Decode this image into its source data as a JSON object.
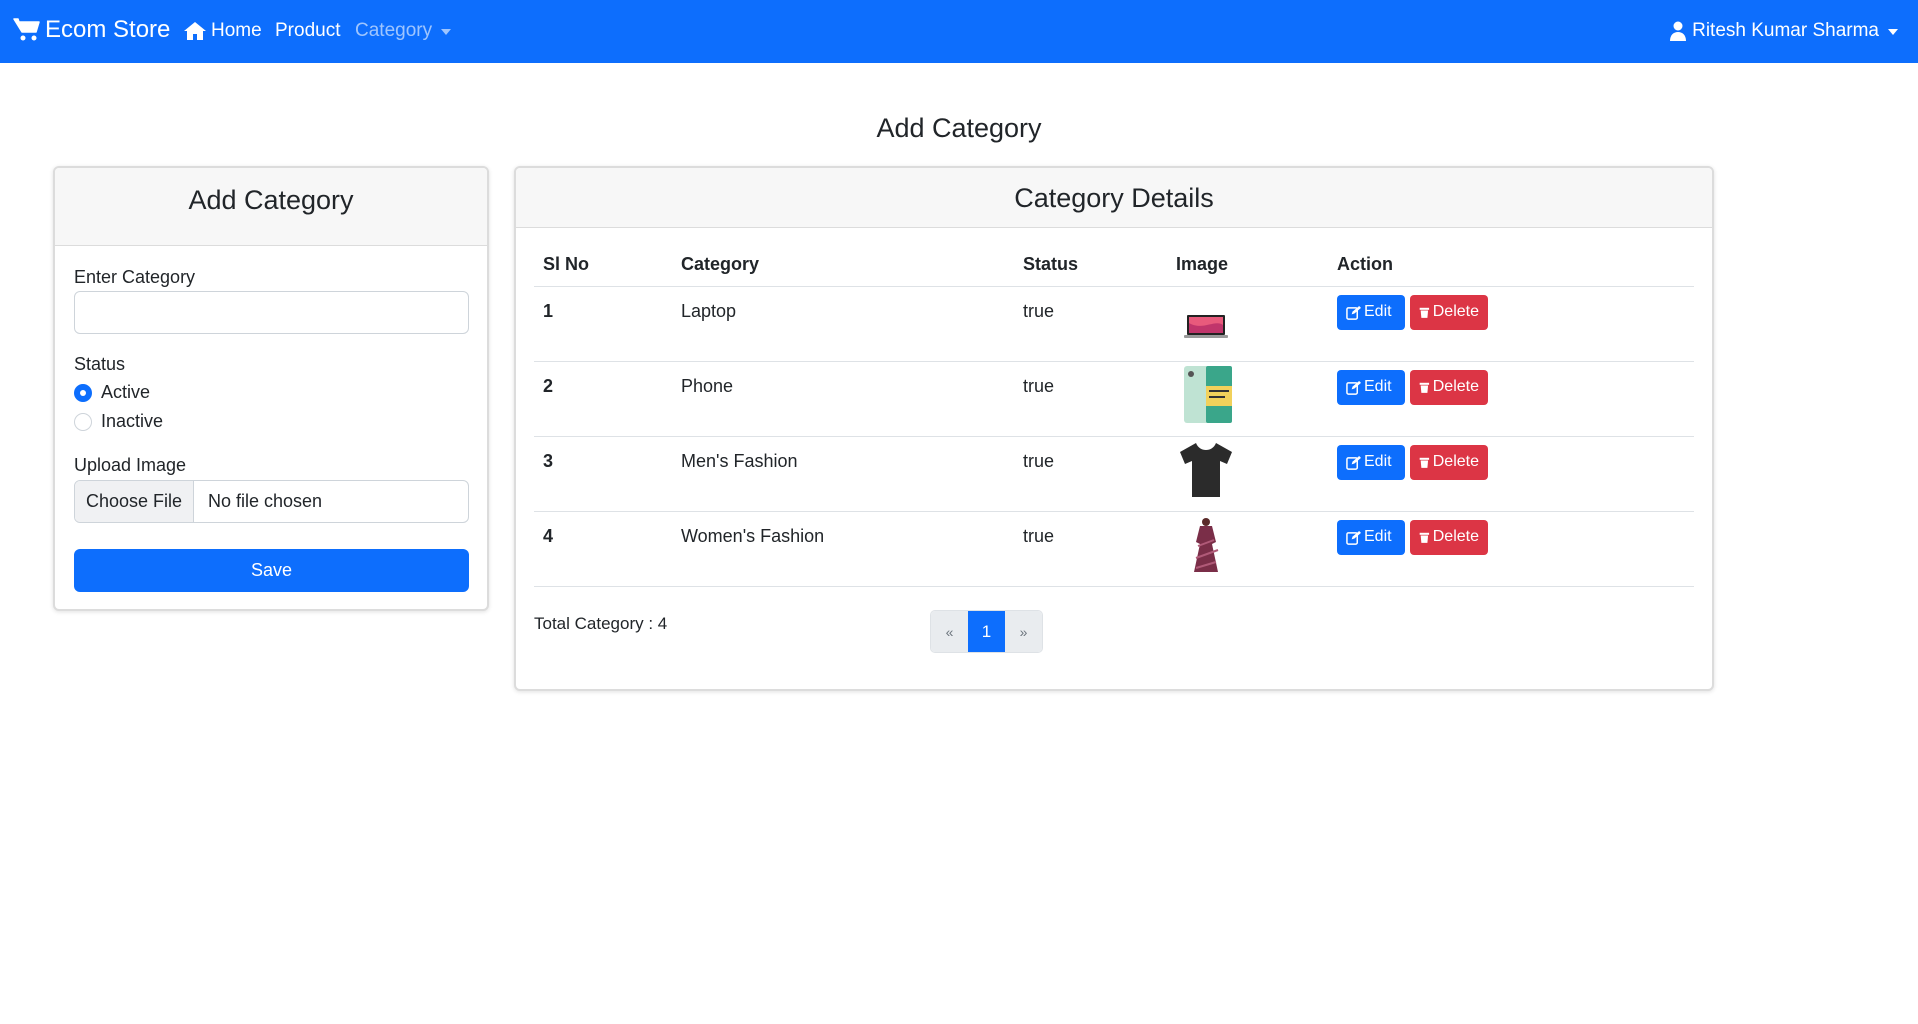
{
  "navbar": {
    "brand": "Ecom Store",
    "home": "Home",
    "product": "Product",
    "category": "Category",
    "user": "Ritesh Kumar Sharma"
  },
  "page_title": "Add Category",
  "form": {
    "header": "Add Category",
    "category_label": "Enter Category",
    "category_value": "",
    "status_label": "Status",
    "status_options": [
      "Active",
      "Inactive"
    ],
    "status_selected": "Active",
    "image_label": "Upload Image",
    "file_button": "Choose File",
    "file_status": "No file chosen",
    "save": "Save"
  },
  "details": {
    "header": "Category Details",
    "columns": [
      "Sl No",
      "Category",
      "Status",
      "Image",
      "Action"
    ],
    "rows": [
      {
        "sl": "1",
        "category": "Laptop",
        "status": "true",
        "image": "laptop-thumbnail"
      },
      {
        "sl": "2",
        "category": "Phone",
        "status": "true",
        "image": "phone-thumbnail"
      },
      {
        "sl": "3",
        "category": "Men's Fashion",
        "status": "true",
        "image": "tshirt-thumbnail"
      },
      {
        "sl": "4",
        "category": "Women's Fashion",
        "status": "true",
        "image": "dress-thumbnail"
      }
    ],
    "edit_label": "Edit",
    "delete_label": "Delete",
    "total": "Total Category : 4",
    "pagination": {
      "prev": "«",
      "current": "1",
      "next": "»"
    }
  },
  "colors": {
    "primary": "#0d6efd",
    "danger": "#dc3545"
  }
}
